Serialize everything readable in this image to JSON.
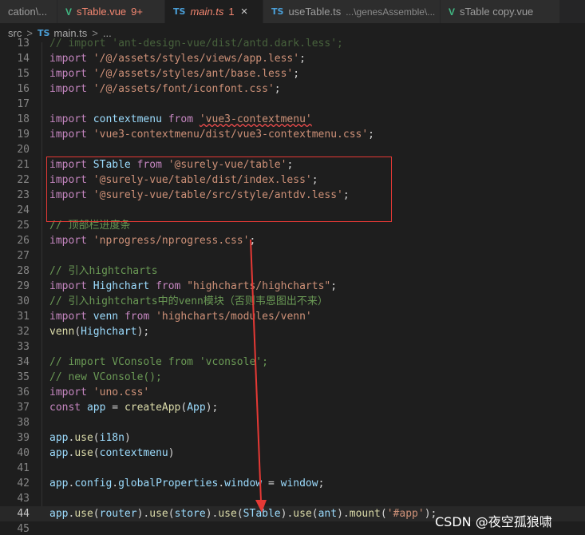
{
  "tabs": [
    {
      "label": "cation\\...",
      "kind": "plain",
      "active": false
    },
    {
      "icon": "V",
      "label": "sTable.vue",
      "badge": "9+",
      "kind": "vue-error",
      "active": false
    },
    {
      "icon": "TS",
      "label": "main.ts",
      "badge": "1",
      "close": "×",
      "kind": "ts-active",
      "active": true
    },
    {
      "icon": "TS",
      "label": "useTable.ts",
      "desc": "...\\genesAssemble\\...",
      "kind": "ts",
      "active": false
    },
    {
      "icon": "V",
      "label": "sTable copy.vue",
      "kind": "vue",
      "active": false
    }
  ],
  "breadcrumb": {
    "folder": "src",
    "sep1": ">",
    "file_icon": "TS",
    "file": "main.ts",
    "sep2": ">",
    "more": "..."
  },
  "watermark": "CSDN @夜空孤狼啸",
  "lines": [
    {
      "n": "13",
      "tokens": [
        [
          "c",
          "// import 'ant-design-vue/dist/antd.dark.less';"
        ]
      ]
    },
    {
      "n": "14",
      "tokens": [
        [
          "k",
          "import"
        ],
        [
          "p",
          " "
        ],
        [
          "s",
          "'/@/assets/styles/views/app.less'"
        ],
        [
          "p",
          ";"
        ]
      ]
    },
    {
      "n": "15",
      "tokens": [
        [
          "k",
          "import"
        ],
        [
          "p",
          " "
        ],
        [
          "s",
          "'/@/assets/styles/ant/base.less'"
        ],
        [
          "p",
          ";"
        ]
      ]
    },
    {
      "n": "16",
      "tokens": [
        [
          "k",
          "import"
        ],
        [
          "p",
          " "
        ],
        [
          "s",
          "'/@/assets/font/iconfont.css'"
        ],
        [
          "p",
          ";"
        ]
      ]
    },
    {
      "n": "17",
      "tokens": []
    },
    {
      "n": "18",
      "tokens": [
        [
          "k",
          "import"
        ],
        [
          "p",
          " "
        ],
        [
          "v",
          "contextmenu"
        ],
        [
          "p",
          " "
        ],
        [
          "k",
          "from"
        ],
        [
          "p",
          " "
        ],
        [
          "s sq",
          "'vue3-contextmenu'"
        ]
      ]
    },
    {
      "n": "19",
      "tokens": [
        [
          "k",
          "import"
        ],
        [
          "p",
          " "
        ],
        [
          "s",
          "'vue3-contextmenu/dist/vue3-contextmenu.css'"
        ],
        [
          "p",
          ";"
        ]
      ]
    },
    {
      "n": "20",
      "tokens": []
    },
    {
      "n": "21",
      "tokens": [
        [
          "k",
          "import"
        ],
        [
          "p",
          " "
        ],
        [
          "v",
          "STable"
        ],
        [
          "p",
          " "
        ],
        [
          "k",
          "from"
        ],
        [
          "p",
          " "
        ],
        [
          "s",
          "'@surely-vue/table'"
        ],
        [
          "p",
          ";"
        ]
      ]
    },
    {
      "n": "22",
      "tokens": [
        [
          "k",
          "import"
        ],
        [
          "p",
          " "
        ],
        [
          "s",
          "'@surely-vue/table/dist/index.less'"
        ],
        [
          "p",
          ";"
        ]
      ]
    },
    {
      "n": "23",
      "tokens": [
        [
          "k",
          "import"
        ],
        [
          "p",
          " "
        ],
        [
          "s",
          "'@surely-vue/table/src/style/antdv.less'"
        ],
        [
          "p",
          ";"
        ]
      ]
    },
    {
      "n": "24",
      "tokens": []
    },
    {
      "n": "25",
      "tokens": [
        [
          "c",
          "// 顶部栏进度条"
        ]
      ]
    },
    {
      "n": "26",
      "tokens": [
        [
          "k",
          "import"
        ],
        [
          "p",
          " "
        ],
        [
          "s",
          "'nprogress/nprogress.css'"
        ],
        [
          "p",
          ";"
        ]
      ]
    },
    {
      "n": "27",
      "tokens": []
    },
    {
      "n": "28",
      "tokens": [
        [
          "c",
          "// 引入hightcharts"
        ]
      ]
    },
    {
      "n": "29",
      "tokens": [
        [
          "k",
          "import"
        ],
        [
          "p",
          " "
        ],
        [
          "v",
          "Highchart"
        ],
        [
          "p",
          " "
        ],
        [
          "k",
          "from"
        ],
        [
          "p",
          " "
        ],
        [
          "s",
          "\"highcharts/highcharts\""
        ],
        [
          "p",
          ";"
        ]
      ]
    },
    {
      "n": "30",
      "tokens": [
        [
          "c",
          "// 引入hightcharts中的venn模块（否则韦恩图出不来）"
        ]
      ]
    },
    {
      "n": "31",
      "tokens": [
        [
          "k",
          "import"
        ],
        [
          "p",
          " "
        ],
        [
          "v",
          "venn"
        ],
        [
          "p",
          " "
        ],
        [
          "k",
          "from"
        ],
        [
          "p",
          " "
        ],
        [
          "s",
          "'highcharts/modules/venn'"
        ]
      ]
    },
    {
      "n": "32",
      "tokens": [
        [
          "f",
          "venn"
        ],
        [
          "p",
          "("
        ],
        [
          "v",
          "Highchart"
        ],
        [
          "p",
          ");"
        ]
      ]
    },
    {
      "n": "33",
      "tokens": []
    },
    {
      "n": "34",
      "tokens": [
        [
          "c",
          "// import VConsole from 'vconsole';"
        ]
      ]
    },
    {
      "n": "35",
      "tokens": [
        [
          "c",
          "// new VConsole();"
        ]
      ]
    },
    {
      "n": "36",
      "tokens": [
        [
          "k",
          "import"
        ],
        [
          "p",
          " "
        ],
        [
          "s",
          "'uno.css'"
        ]
      ]
    },
    {
      "n": "37",
      "tokens": [
        [
          "k",
          "const"
        ],
        [
          "p",
          " "
        ],
        [
          "v",
          "app"
        ],
        [
          "p",
          " = "
        ],
        [
          "f",
          "createApp"
        ],
        [
          "p",
          "("
        ],
        [
          "v",
          "App"
        ],
        [
          "p",
          ");"
        ]
      ]
    },
    {
      "n": "38",
      "tokens": []
    },
    {
      "n": "39",
      "tokens": [
        [
          "v",
          "app"
        ],
        [
          "p",
          "."
        ],
        [
          "f",
          "use"
        ],
        [
          "p",
          "("
        ],
        [
          "v",
          "i18n"
        ],
        [
          "p",
          ")"
        ]
      ]
    },
    {
      "n": "40",
      "tokens": [
        [
          "v",
          "app"
        ],
        [
          "p",
          "."
        ],
        [
          "f",
          "use"
        ],
        [
          "p",
          "("
        ],
        [
          "v",
          "contextmenu"
        ],
        [
          "p",
          ")"
        ]
      ]
    },
    {
      "n": "41",
      "tokens": []
    },
    {
      "n": "42",
      "tokens": [
        [
          "v",
          "app"
        ],
        [
          "p",
          "."
        ],
        [
          "v",
          "config"
        ],
        [
          "p",
          "."
        ],
        [
          "v",
          "globalProperties"
        ],
        [
          "p",
          "."
        ],
        [
          "v",
          "window"
        ],
        [
          "p",
          " = "
        ],
        [
          "v",
          "window"
        ],
        [
          "p",
          ";"
        ]
      ]
    },
    {
      "n": "43",
      "tokens": []
    },
    {
      "n": "44",
      "current": true,
      "tokens": [
        [
          "v",
          "app"
        ],
        [
          "p",
          "."
        ],
        [
          "f",
          "use"
        ],
        [
          "p",
          "("
        ],
        [
          "v",
          "router"
        ],
        [
          "p",
          ")."
        ],
        [
          "f",
          "use"
        ],
        [
          "p",
          "("
        ],
        [
          "v",
          "store"
        ],
        [
          "p",
          ")."
        ],
        [
          "f",
          "use"
        ],
        [
          "p",
          "("
        ],
        [
          "v",
          "STable"
        ],
        [
          "p",
          ")."
        ],
        [
          "f",
          "use"
        ],
        [
          "p",
          "("
        ],
        [
          "v",
          "ant"
        ],
        [
          "p",
          ")."
        ],
        [
          "f",
          "mount"
        ],
        [
          "p",
          "("
        ],
        [
          "s",
          "'#app'"
        ],
        [
          "p",
          ");"
        ]
      ]
    },
    {
      "n": "45",
      "tokens": []
    }
  ]
}
